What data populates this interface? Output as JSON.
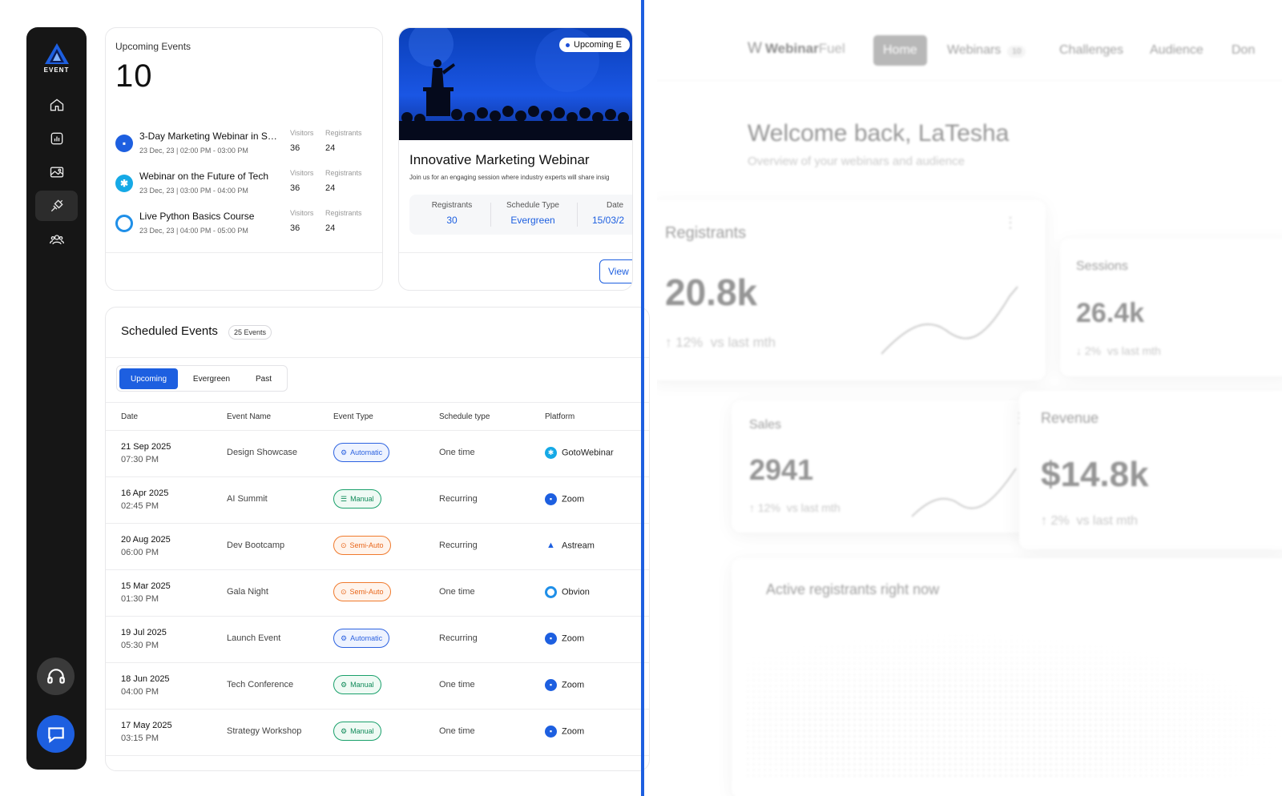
{
  "sidebar": {
    "logo_text": "EVENT",
    "nav_items": [
      {
        "icon": "home-icon"
      },
      {
        "icon": "analytics-icon"
      },
      {
        "icon": "gallery-icon"
      },
      {
        "icon": "integrations-icon"
      },
      {
        "icon": "audience-icon"
      }
    ]
  },
  "upcoming": {
    "title": "Upcoming Events",
    "count": "10",
    "events": [
      {
        "name": "3-Day Marketing Webinar in Sa...",
        "date": "23 Dec, 23 | 02:00 PM - 03:00 PM",
        "visitors_label": "Visitors",
        "registrants_label": "Registrants",
        "visitors": "36",
        "registrants": "24",
        "icon_color": "#1d5fe0"
      },
      {
        "name": "Webinar on the Future of Tech",
        "date": "23 Dec, 23 | 03:00 PM - 04:00 PM",
        "visitors_label": "Visitors",
        "registrants_label": "Registrants",
        "visitors": "36",
        "registrants": "24",
        "icon_color": "#15a9e6"
      },
      {
        "name": "Live Python Basics Course",
        "date": "23 Dec, 23 | 04:00 PM - 05:00 PM",
        "visitors_label": "Visitors",
        "registrants_label": "Registrants",
        "visitors": "36",
        "registrants": "24",
        "icon_color": "#1f8fe8"
      }
    ]
  },
  "featured": {
    "badge": "Upcoming E",
    "title": "Innovative Marketing Webinar",
    "description": "Join us for an engaging session where industry experts will share insig",
    "stats": [
      {
        "label": "Registrants",
        "value": "30"
      },
      {
        "label": "Schedule Type",
        "value": "Evergreen"
      },
      {
        "label": "Date",
        "value": "15/03/2"
      }
    ],
    "view_label": "View"
  },
  "scheduled": {
    "title": "Scheduled Events",
    "count_badge": "25 Events",
    "tabs": [
      "Upcoming",
      "Evergreen",
      "Past"
    ],
    "columns": [
      "Date",
      "Event Name",
      "Event Type",
      "Schedule type",
      "Platform"
    ],
    "rows": [
      {
        "date": "21 Sep 2025",
        "time": "07:30 PM",
        "name": "Design Showcase",
        "type": "Automatic",
        "schedule": "One time",
        "platform": "GotoWebinar"
      },
      {
        "date": "16 Apr 2025",
        "time": "02:45 PM",
        "name": "AI Summit",
        "type": "Manual",
        "schedule": "Recurring",
        "platform": "Zoom"
      },
      {
        "date": "20 Aug 2025",
        "time": "06:00 PM",
        "name": "Dev Bootcamp",
        "type": "Semi-Auto",
        "schedule": "Recurring",
        "platform": "Astream"
      },
      {
        "date": "15 Mar 2025",
        "time": "01:30 PM",
        "name": "Gala Night",
        "type": "Semi-Auto",
        "schedule": "One time",
        "platform": "Obvion"
      },
      {
        "date": "19 Jul 2025",
        "time": "05:30 PM",
        "name": "Launch Event",
        "type": "Automatic",
        "schedule": "Recurring",
        "platform": "Zoom"
      },
      {
        "date": "18 Jun 2025",
        "time": "04:00 PM",
        "name": "Tech Conference",
        "type": "Manual",
        "schedule": "One time",
        "platform": "Zoom"
      },
      {
        "date": "17 May 2025",
        "time": "03:15 PM",
        "name": "Strategy Workshop",
        "type": "Manual",
        "schedule": "One time",
        "platform": "Zoom"
      }
    ]
  },
  "right_panel": {
    "brand_a": "Webinar",
    "brand_b": "Fuel",
    "nav": [
      "Home",
      "Webinars",
      "Challenges",
      "Audience",
      "Don"
    ],
    "webinars_count": "10",
    "welcome": "Welcome back, LaTesha",
    "overview": "Overview of your webinars and audience",
    "metrics": [
      {
        "label": "Registrants",
        "value": "20.8k",
        "delta": "12%",
        "delta_suffix": "vs last mth",
        "trend": "up"
      },
      {
        "label": "Sessions",
        "value": "26.4k",
        "delta": "2%",
        "delta_suffix": "vs last mth",
        "trend": "down"
      },
      {
        "label": "Sales",
        "value": "2941",
        "delta": "12%",
        "delta_suffix": "vs last mth",
        "trend": "up"
      },
      {
        "label": "Revenue",
        "value": "$14.8k",
        "delta": "2%",
        "delta_suffix": "vs last mth",
        "trend": "up"
      }
    ],
    "active_label": "Active registrants right now"
  },
  "colors": {
    "accent": "#1d5fe0",
    "sidebar_bg": "#161616",
    "automatic": "#2c62e0",
    "manual": "#19a06b",
    "semi_auto": "#f07a2d"
  }
}
